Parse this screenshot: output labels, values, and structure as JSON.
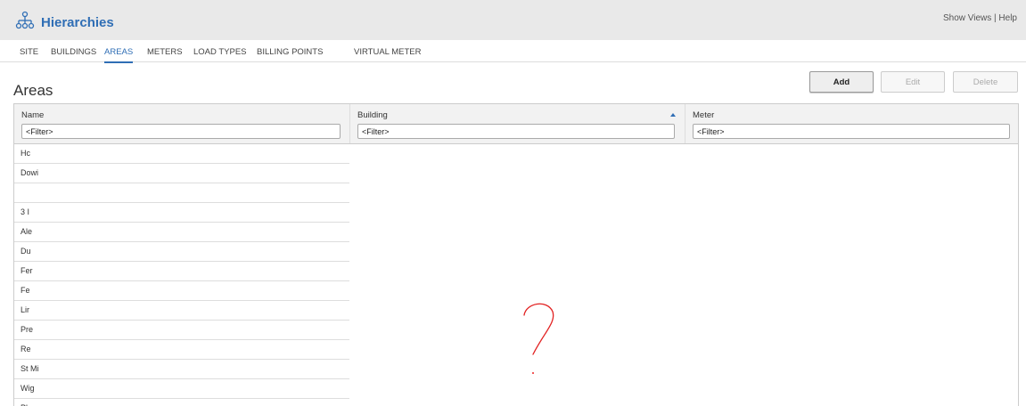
{
  "header": {
    "title": "Hierarchies",
    "show_views": "Show Views",
    "separator": " | ",
    "help": "Help",
    "logo_icon": "hierarchy-icon"
  },
  "tabs": [
    {
      "label": "SITE"
    },
    {
      "label": "BUILDINGS"
    },
    {
      "label": "AREAS",
      "active": true
    },
    {
      "label": "METERS"
    },
    {
      "label": "LOAD TYPES"
    },
    {
      "label": "BILLING POINTS"
    },
    {
      "label": "VIRTUAL METER"
    }
  ],
  "page": {
    "title": "Areas"
  },
  "toolbar": {
    "add": "Add",
    "edit": "Edit",
    "delete": "Delete"
  },
  "grid": {
    "columns": [
      {
        "title": "Name",
        "filter": "<Filter>"
      },
      {
        "title": "Building",
        "filter": "<Filter>",
        "sort": "ascending"
      },
      {
        "title": "Meter",
        "filter": "<Filter>"
      }
    ],
    "rows": [
      "Hc",
      "Dowi",
      "",
      "3 I",
      "Ale",
      "Du",
      "Fer",
      "Fe",
      "Lir",
      "Pre",
      "Re",
      "St Mi",
      "Wig",
      "Plen"
    ]
  },
  "colors": {
    "accent": "#2f6eb5",
    "annotation": "#e22222"
  }
}
